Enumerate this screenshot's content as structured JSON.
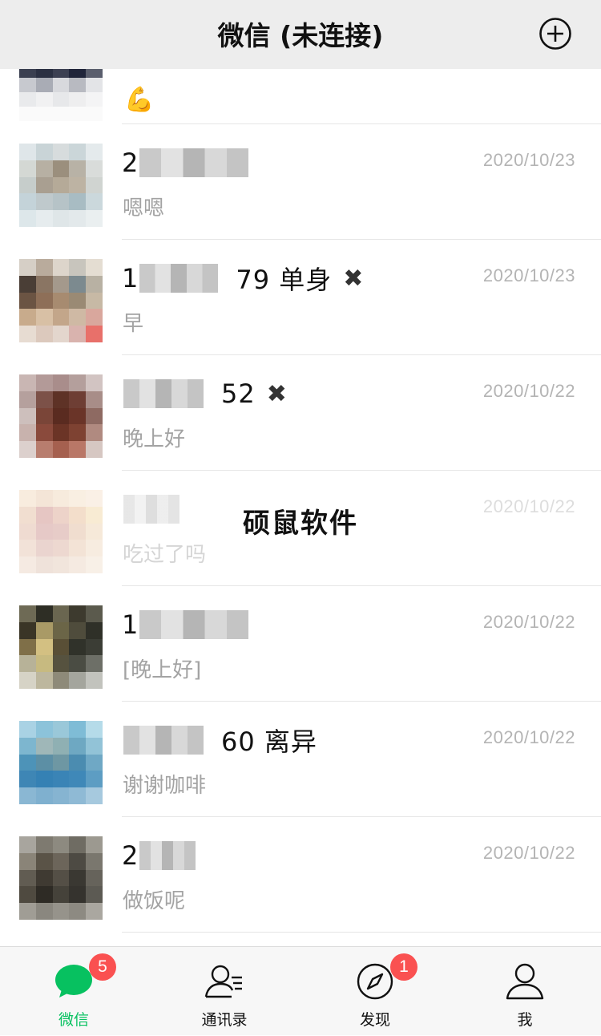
{
  "header": {
    "title": "微信 (未连接)"
  },
  "chats": [
    {
      "name_prefix": "",
      "name_suffix": "",
      "message": "💪",
      "time": ""
    },
    {
      "name_prefix": "2",
      "name_suffix": "",
      "message": "嗯嗯",
      "time": "2020/10/23"
    },
    {
      "name_prefix": "1",
      "name_suffix": "79  单身",
      "message": "早",
      "time": "2020/10/23"
    },
    {
      "name_prefix": "",
      "name_suffix": "52",
      "message": "晚上好",
      "time": "2020/10/22"
    },
    {
      "name_prefix": "",
      "name_suffix": "",
      "message": "吃过了吗",
      "time": "2020/10/22"
    },
    {
      "name_prefix": "1",
      "name_suffix": "",
      "message": "[晚上好]",
      "time": "2020/10/22"
    },
    {
      "name_prefix": "",
      "name_suffix": "60  离异",
      "message": "谢谢咖啡",
      "time": "2020/10/22"
    },
    {
      "name_prefix": "2",
      "name_suffix": "",
      "message": "做饭呢",
      "time": "2020/10/22"
    }
  ],
  "watermark": "硕鼠软件",
  "tabbar": {
    "tabs": [
      {
        "label": "微信",
        "badge": "5"
      },
      {
        "label": "通讯录",
        "badge": ""
      },
      {
        "label": "发现",
        "badge": "1"
      },
      {
        "label": "我",
        "badge": ""
      }
    ]
  },
  "colors": {
    "accent_green": "#07c160",
    "badge_red": "#fa5151",
    "header_bg": "#ededed"
  }
}
